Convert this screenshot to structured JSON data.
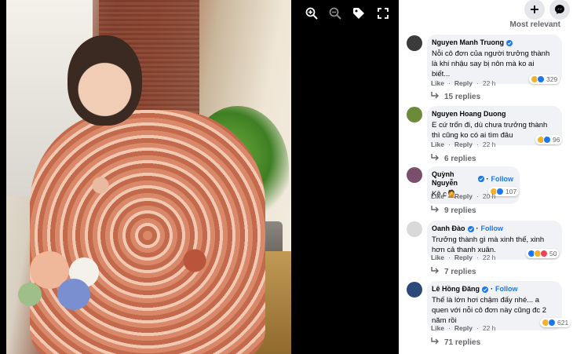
{
  "viewer": {
    "icons": [
      "zoom-in-icon",
      "zoom-out-icon",
      "tag-icon",
      "fullscreen-icon"
    ]
  },
  "panel": {
    "top_icons": [
      "plus-icon",
      "messenger-icon"
    ],
    "sort_label": "Most relevant"
  },
  "comments": [
    {
      "author": "Nguyen Manh Truong",
      "verified": true,
      "follow": "",
      "text_lines": [
        "Nỗi cô đơn của người trưởng thành",
        "là khi nhậu say bị nôn mà ko ai",
        "biết..."
      ],
      "like": "Like",
      "reply": "Reply",
      "time": "22 h",
      "reaction_count": "329",
      "reactions": [
        "haha",
        "like"
      ],
      "replies": "15 replies",
      "avatar_color": "#3b3b3b"
    },
    {
      "author": "Nguyen Hoang Duong",
      "verified": false,
      "follow": "",
      "text_lines": [
        "E cứ trốn đi, dù chưa trưởng thành",
        "thì cũng ko có ai tìm đâu"
      ],
      "like": "Like",
      "reply": "Reply",
      "time": "22 h",
      "reaction_count": "96",
      "reactions": [
        "haha",
        "like"
      ],
      "replies": "6 replies",
      "avatar_color": "#6c8a3a"
    },
    {
      "author": "Quỳnh Nguyễn",
      "verified": true,
      "follow": "Follow",
      "text_lines": [
        "Kệ c🤦"
      ],
      "like": "Like",
      "reply": "Reply",
      "time": "20 h",
      "reaction_count": "107",
      "reactions": [
        "haha",
        "like"
      ],
      "replies": "9 replies",
      "avatar_color": "#7a4f6e"
    },
    {
      "author": "Oanh Đào",
      "verified": true,
      "follow": "Follow",
      "text_lines": [
        "Trưởng thành gì mà xinh thế, xinh",
        "hơn cả thanh xuân."
      ],
      "like": "Like",
      "reply": "Reply",
      "time": "22 h",
      "reaction_count": "50",
      "reactions": [
        "like",
        "haha",
        "love"
      ],
      "replies": "7 replies",
      "avatar_color": "#d9d9d9"
    },
    {
      "author": "Lê Hồng Đăng",
      "verified": true,
      "follow": "Follow",
      "text_lines": [
        "Thế là lớn hơi chậm đấy nhé... a",
        "quen với nỗi cô đơn này cũng đc 2",
        "năm rồi"
      ],
      "like": "Like",
      "reply": "Reply",
      "time": "22 h",
      "reaction_count": "621",
      "reactions": [
        "haha",
        "like"
      ],
      "replies": "71 replies",
      "avatar_color": "#2b4a7a"
    }
  ],
  "colors": {
    "accent": "#1877f2",
    "bubble": "#f0f2f5",
    "muted": "#65676b"
  }
}
